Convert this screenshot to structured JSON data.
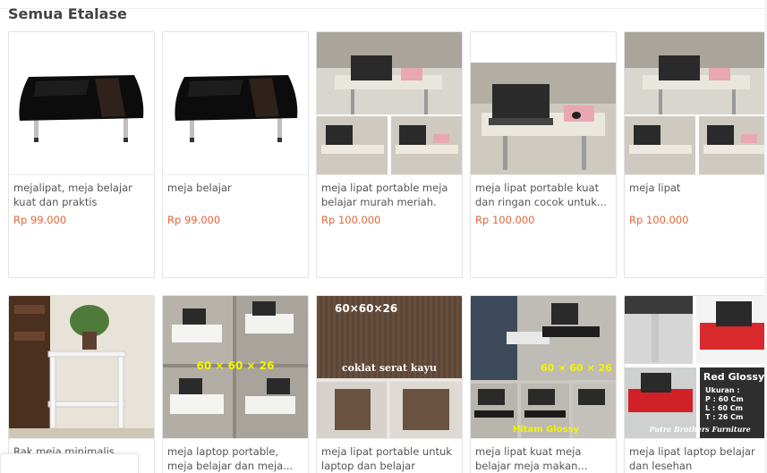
{
  "section": {
    "title": "Semua Etalase"
  },
  "products": [
    {
      "name": "mejalipat, meja belajar kuat dan praktis",
      "price": "Rp 99.000",
      "image": "black-table"
    },
    {
      "name": "meja belajar",
      "price": "Rp 99.000",
      "image": "black-table"
    },
    {
      "name": "meja lipat portable meja belajar murah meriah.",
      "price": "Rp 100.000",
      "image": "laptop-table-collage"
    },
    {
      "name": "meja lipat portable kuat dan ringan cocok untuk...",
      "price": "Rp 100.000",
      "image": "laptop-table-single"
    },
    {
      "name": "meja lipat",
      "price": "Rp 100.000",
      "image": "laptop-table-collage"
    },
    {
      "name": "Rak meja minimalis",
      "price": "",
      "image": "shelf-rack"
    },
    {
      "name": "meja laptop portable, meja belajar dan meja...",
      "price": "",
      "image": "white-table-collage"
    },
    {
      "name": "meja lipat portable untuk laptop dan belajar",
      "price": "",
      "image": "wood-table-collage"
    },
    {
      "name": "meja lipat kuat meja belajar meja makan...",
      "price": "",
      "image": "person-laptop-collage"
    },
    {
      "name": "meja lipat laptop belajar dan lesehan",
      "price": "",
      "image": "red-glossy-collage"
    }
  ],
  "image_text": {
    "wood_size": "60×60×26",
    "wood_caption": "coklat serat kayu",
    "white_size": "60 × 60 × 26",
    "person_size": "60 × 60 × 26",
    "person_caption": "Hitam Glossy",
    "red_title": "Red Glossy",
    "red_ukuran": "Ukuran :",
    "red_p": "P : 60 Cm",
    "red_l": "L : 60 Cm",
    "red_t": "T : 26 Cm",
    "red_brand": "Putra Brothers Furniture"
  }
}
